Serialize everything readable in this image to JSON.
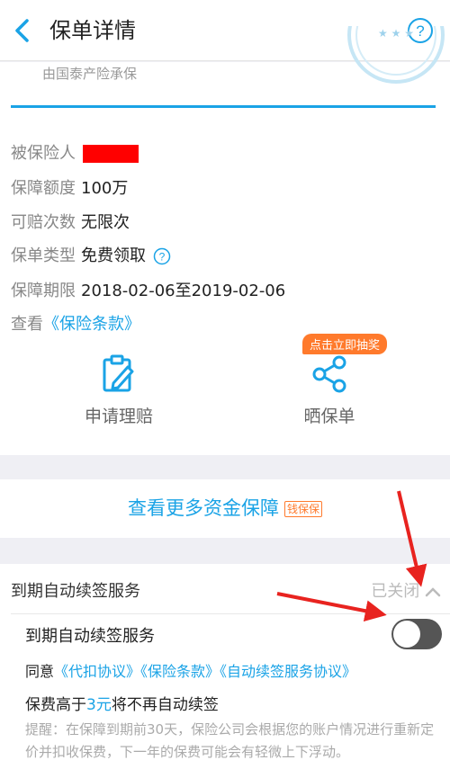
{
  "header": {
    "title": "保单详情"
  },
  "policy": {
    "insurer": "由国泰产险承保",
    "rows": [
      {
        "label": "被保险人",
        "value": ""
      },
      {
        "label": "保障额度",
        "value": "100万"
      },
      {
        "label": "可赔次数",
        "value": "无限次"
      },
      {
        "label": "保单类型",
        "value": "免费领取"
      },
      {
        "label": "保障期限",
        "value": "2018-02-06至2019-02-06"
      }
    ],
    "view_prefix": "查看",
    "terms_link": "《保险条款》"
  },
  "actions": {
    "claim_label": "申请理赔",
    "share_label": "晒保单",
    "share_badge": "点击立即抽奖"
  },
  "more": {
    "label": "查看更多资金保障",
    "tag": "钱保保"
  },
  "renewal": {
    "heading": "到期自动续签服务",
    "status": "已关闭",
    "switch_label": "到期自动续签服务",
    "switch_on": false,
    "agree_prefix": "同意",
    "agreements": [
      "《代扣协议》",
      "《保险条款》",
      "《自动续签服务协议》"
    ],
    "premium_prefix": "保费高于",
    "premium_amount": "3元",
    "premium_suffix": "将不再自动续签",
    "notice": "提醒：在保障到期前30天，保险公司会根据您的账户情况进行重新定价并扣收保费，下一年的保费可能会有轻微上下浮动。"
  },
  "colors": {
    "accent": "#1aa3e6",
    "badge": "#ff7a2c",
    "annotation_arrow": "#e8231f"
  }
}
